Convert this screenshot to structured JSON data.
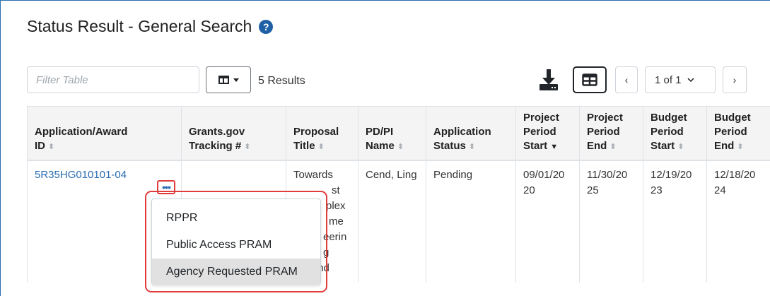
{
  "page": {
    "title": "Status Result - General Search",
    "help_icon": "question-circle-icon"
  },
  "toolbar": {
    "filter_placeholder": "Filter Table",
    "results_label": "5 Results",
    "page_label": "1 of 1",
    "prev_label": "‹",
    "next_label": "›"
  },
  "table": {
    "headers": [
      {
        "lines": [
          "Application/Award",
          "ID"
        ],
        "sort": "none"
      },
      {
        "lines": [
          "Grants.gov",
          "Tracking #"
        ],
        "sort": "none"
      },
      {
        "lines": [
          "Proposal",
          "Title"
        ],
        "sort": "none"
      },
      {
        "lines": [
          "PD/PI",
          "Name"
        ],
        "sort": "none"
      },
      {
        "lines": [
          "Application",
          "Status"
        ],
        "sort": "none"
      },
      {
        "lines": [
          "Project",
          "Period",
          "Start"
        ],
        "sort": "desc"
      },
      {
        "lines": [
          "Project",
          "Period",
          "End"
        ],
        "sort": "none"
      },
      {
        "lines": [
          "Budget",
          "Period",
          "Start"
        ],
        "sort": "none"
      },
      {
        "lines": [
          "Budget",
          "Period",
          "End"
        ],
        "sort": "none"
      }
    ],
    "row": {
      "award_id": "5R35HG010101-04",
      "tracking": "",
      "proposal_title_visible": "Towards",
      "title_fragments": [
        "st",
        "plex",
        "me",
        "eerin",
        "g Beyond"
      ],
      "pi_name": "Cend, Ling",
      "status": "Pending",
      "project_start": "09/01/20 20",
      "project_end": "11/30/20 25",
      "budget_start": "12/19/20 23",
      "budget_end": "12/18/20 24"
    }
  },
  "actions_menu": {
    "items": [
      "RPPR",
      "Public Access PRAM",
      "Agency Requested PRAM"
    ],
    "active_index": 2
  },
  "colors": {
    "link": "#2a6db0",
    "highlight": "#e03c3c",
    "header_bg": "#f4f4f4"
  }
}
